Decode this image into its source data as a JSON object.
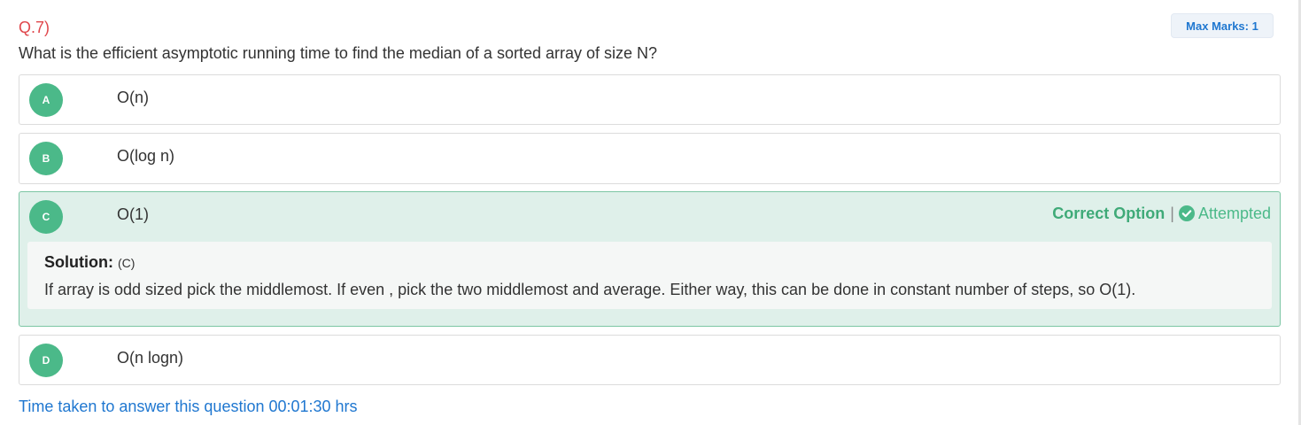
{
  "question": {
    "number": "Q.7)",
    "max_marks": "Max Marks: 1",
    "text": "What is the efficient asymptotic running time to find the median of a sorted array of size N?"
  },
  "options": [
    {
      "letter": "A",
      "text": "O(n)"
    },
    {
      "letter": "B",
      "text": "O(log n)"
    },
    {
      "letter": "C",
      "text": "O(1)"
    },
    {
      "letter": "D",
      "text": "O(n logn)"
    }
  ],
  "status": {
    "correct_label": "Correct Option",
    "separator": "|",
    "check_icon": "check-circle-icon",
    "attempted_label": "Attempted"
  },
  "solution": {
    "label": "Solution:",
    "answer": "(C)",
    "text": "If array is odd sized pick the middlemost. If even , pick the two middlemost and average. Either way, this can be done in constant number of steps, so O(1)."
  },
  "time_taken": "Time taken to answer this question 00:01:30 hrs",
  "colors": {
    "accent_blue": "#1f77d0",
    "question_red": "#e0474c",
    "correct_green": "#4bb989",
    "correct_bg": "#dff0ea"
  }
}
